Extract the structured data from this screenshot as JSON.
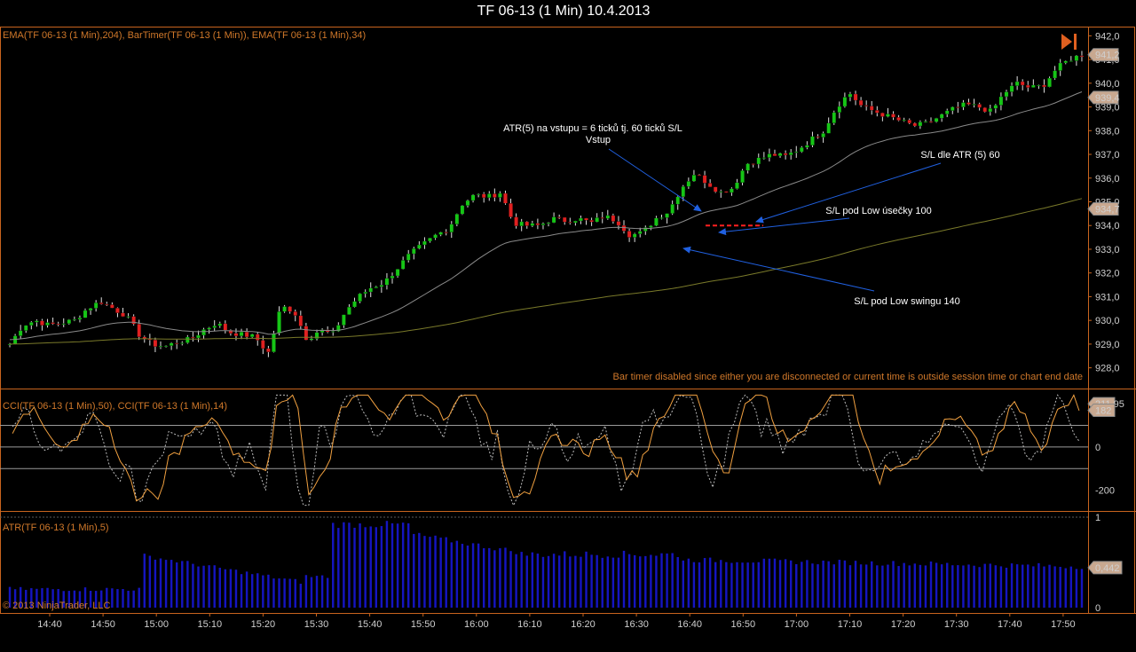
{
  "window": {
    "title": "TF 06-13 (1 Min)  10.4.2013"
  },
  "colors": {
    "frame": "#c8641e",
    "up": "#16c516",
    "down": "#e02020",
    "ema_fast": "#8a8a8a",
    "ema_slow": "#7a7a2a",
    "cci_fast": "#f0a040",
    "cci_slow": "#bbbbbb",
    "atr_bar": "#1515c0",
    "arrow": "#2060e0",
    "entry_line": "#ff2020",
    "price_box": "#c8a890"
  },
  "panels": {
    "price": {
      "label": "EMA(TF 06-13 (1 Min),204), BarTimer(TF 06-13 (1 Min)), EMA(TF 06-13 (1 Min),34)",
      "bar_timer_msg": "Bar timer disabled since either you are disconnected or current time is outside session time or chart end date",
      "play_icon": "play-to-end-icon"
    },
    "cci": {
      "label": "CCI(TF 06-13 (1 Min),50), CCI(TF 06-13 (1 Min),14)"
    },
    "atr": {
      "label": "ATR(TF 06-13 (1 Min),5)",
      "copyright": "© 2013 NinjaTrader, LLC"
    }
  },
  "annotations": {
    "entry_atr": "ATR(5) na vstupu = 6 ticků tj. 60 ticků S/L",
    "entry": "Vstup",
    "sl_atr": "S/L dle ATR (5) 60",
    "sl_low_bar": "S/L pod Low úsečky 100",
    "sl_swing": "S/L pod Low swingu 140"
  },
  "chart_data": [
    {
      "type": "candlestick",
      "title": "TF 06-13 (1 Min)  10.4.2013",
      "x_ticks": [
        "14:40",
        "14:50",
        "15:00",
        "15:10",
        "15:20",
        "15:30",
        "15:40",
        "15:50",
        "16:00",
        "16:10",
        "16:20",
        "16:30",
        "16:40",
        "16:50",
        "17:00",
        "17:10",
        "17:20",
        "17:30",
        "17:40",
        "17:50"
      ],
      "y_ticks": [
        "942,0",
        "941,0",
        "940,0",
        "939,0",
        "938,0",
        "937,0",
        "936,0",
        "935,0",
        "934,0",
        "933,0",
        "932,0",
        "931,0",
        "930,0",
        "929,0",
        "928,0"
      ],
      "ylim": [
        927.5,
        942.2
      ],
      "close_path": [
        929.0,
        929.8,
        930.0,
        929.8,
        929.9,
        930.0,
        930.5,
        930.8,
        930.5,
        930.2,
        929.4,
        929.0,
        928.9,
        929.1,
        929.2,
        929.6,
        929.9,
        929.5,
        929.4,
        929.3,
        928.6,
        930.6,
        930.4,
        929.2,
        929.6,
        929.4,
        930.4,
        931.0,
        931.4,
        931.6,
        932.2,
        932.8,
        933.2,
        933.6,
        933.9,
        934.9,
        935.3,
        935.2,
        935.4,
        934.1,
        934.0,
        934.0,
        934.3,
        934.2,
        934.3,
        934.1,
        934.4,
        934.2,
        933.6,
        933.7,
        934.3,
        934.6,
        935.6,
        936.2,
        935.8,
        935.4,
        935.6,
        936.6,
        936.8,
        937.0,
        936.9,
        937.2,
        937.6,
        938.0,
        939.0,
        939.6,
        939.0,
        938.8,
        938.6,
        938.4,
        938.2,
        938.3,
        938.6,
        938.9,
        939.1,
        939.0,
        938.8,
        939.6,
        940.0,
        939.8,
        939.9,
        940.6,
        941.0,
        941.2
      ],
      "last_price": "941,2",
      "ema34_last": "939,4",
      "ema204_last": "934,7",
      "ema34_start": 929.2,
      "ema204_start": 929.0,
      "entry_price": 934.0
    },
    {
      "type": "line",
      "series": [
        {
          "name": "CCI(TF 06-13 (1 Min),50)"
        },
        {
          "name": "CCI(TF 06-13 (1 Min),14)"
        }
      ],
      "y_ticks": [
        "0",
        "-200"
      ],
      "hlines": [
        100,
        0,
        -100
      ],
      "ylim": [
        -280,
        250
      ],
      "last_values": [
        "211,95",
        "182"
      ]
    },
    {
      "type": "bar",
      "series": [
        {
          "name": "ATR(TF 06-13 (1 Min),5)"
        }
      ],
      "y_ticks": [
        "1",
        "0"
      ],
      "ylim": [
        0,
        1
      ],
      "last_value": "0,442"
    }
  ]
}
